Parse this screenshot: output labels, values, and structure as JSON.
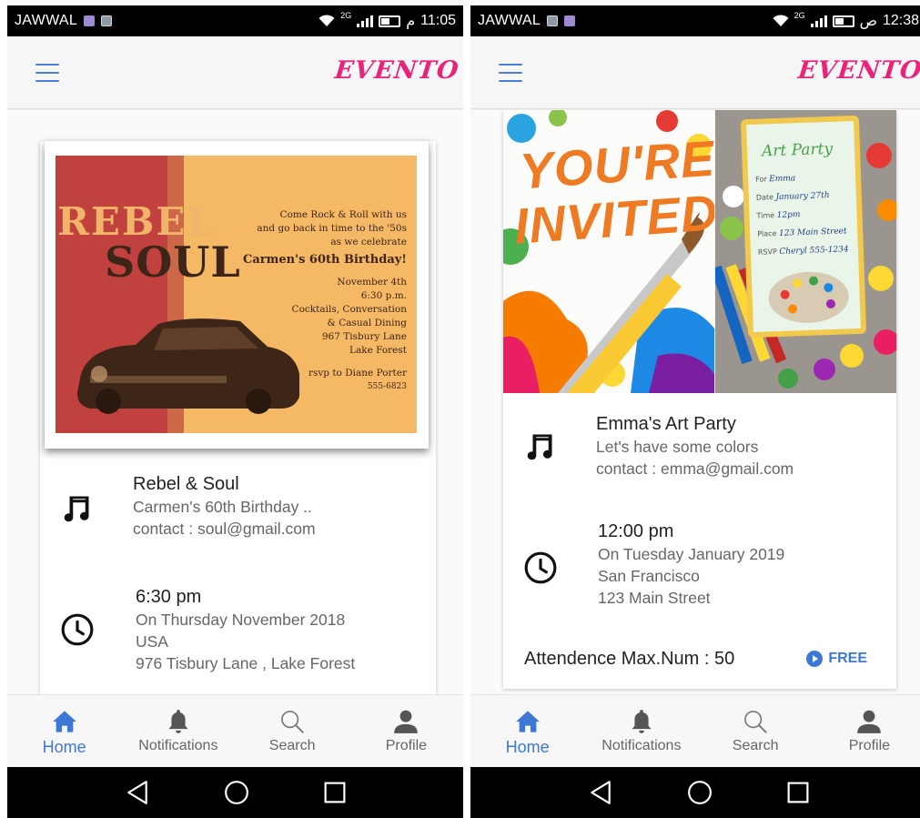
{
  "screens": [
    {
      "status": {
        "carrier": "JAWWAL",
        "network": "2G",
        "ampm": "م",
        "time": "11:05"
      },
      "app": {
        "logo": "EVENTO"
      },
      "invitation": {
        "title_line1": "REBEL",
        "title_line2": "SOUL",
        "text_lines": [
          "Come Rock & Roll with us",
          "and go back in time to the '50s",
          "as we celebrate"
        ],
        "headline": "Carmen's 60th Birthday!",
        "details": [
          "November 4th",
          "6:30 p.m.",
          "Cocktails, Conversation",
          "& Casual Dining",
          "967 Tisbury Lane",
          "Lake Forest"
        ],
        "rsvp": "rsvp to Diane Porter",
        "rsvp_phone": "555-6823"
      },
      "event": {
        "name": "Rebel & Soul",
        "description": "Carmen's 60th Birthday ..",
        "contact": "contact : soul@gmail.com",
        "time": "6:30 pm",
        "date": "On Thursday November 2018",
        "location": "USA",
        "address": "976 Tisbury Lane , Lake Forest"
      },
      "nav": [
        {
          "label": "Home",
          "icon": "home-icon",
          "active": true
        },
        {
          "label": "Notifications",
          "icon": "bell-icon",
          "active": false
        },
        {
          "label": "Search",
          "icon": "search-icon",
          "active": false
        },
        {
          "label": "Profile",
          "icon": "person-icon",
          "active": false
        }
      ]
    },
    {
      "status": {
        "carrier": "JAWWAL",
        "network": "2G",
        "ampm": "ص",
        "time": "12:38"
      },
      "app": {
        "logo": "EVENTO"
      },
      "invitation": {
        "headline1": "YOU'RE",
        "headline2": "INVITED",
        "card_title": "Art Party",
        "card_fields": [
          {
            "label": "For",
            "value": "Emma"
          },
          {
            "label": "Date",
            "value": "January 27th"
          },
          {
            "label": "Time",
            "value": "12pm"
          },
          {
            "label": "Place",
            "value": "123 Main Street"
          },
          {
            "label": "RSVP",
            "value": "Cheryl 555-1234"
          }
        ]
      },
      "event": {
        "name": "Emma's Art Party",
        "description": "Let's have some colors",
        "contact": "contact : emma@gmail.com",
        "time": "12:00 pm",
        "date": "On Tuesday January 2019",
        "location": "San Francisco",
        "address": "123 Main Street",
        "attendance": "Attendence Max.Num : 50",
        "price": "FREE"
      },
      "nav": [
        {
          "label": "Home",
          "icon": "home-icon",
          "active": true
        },
        {
          "label": "Notifications",
          "icon": "bell-icon",
          "active": false
        },
        {
          "label": "Search",
          "icon": "search-icon",
          "active": false
        },
        {
          "label": "Profile",
          "icon": "person-icon",
          "active": false
        }
      ]
    }
  ],
  "colors": {
    "accent": "#3d78d6",
    "logo": "#e9237a",
    "menu": "#4a7fd6"
  }
}
